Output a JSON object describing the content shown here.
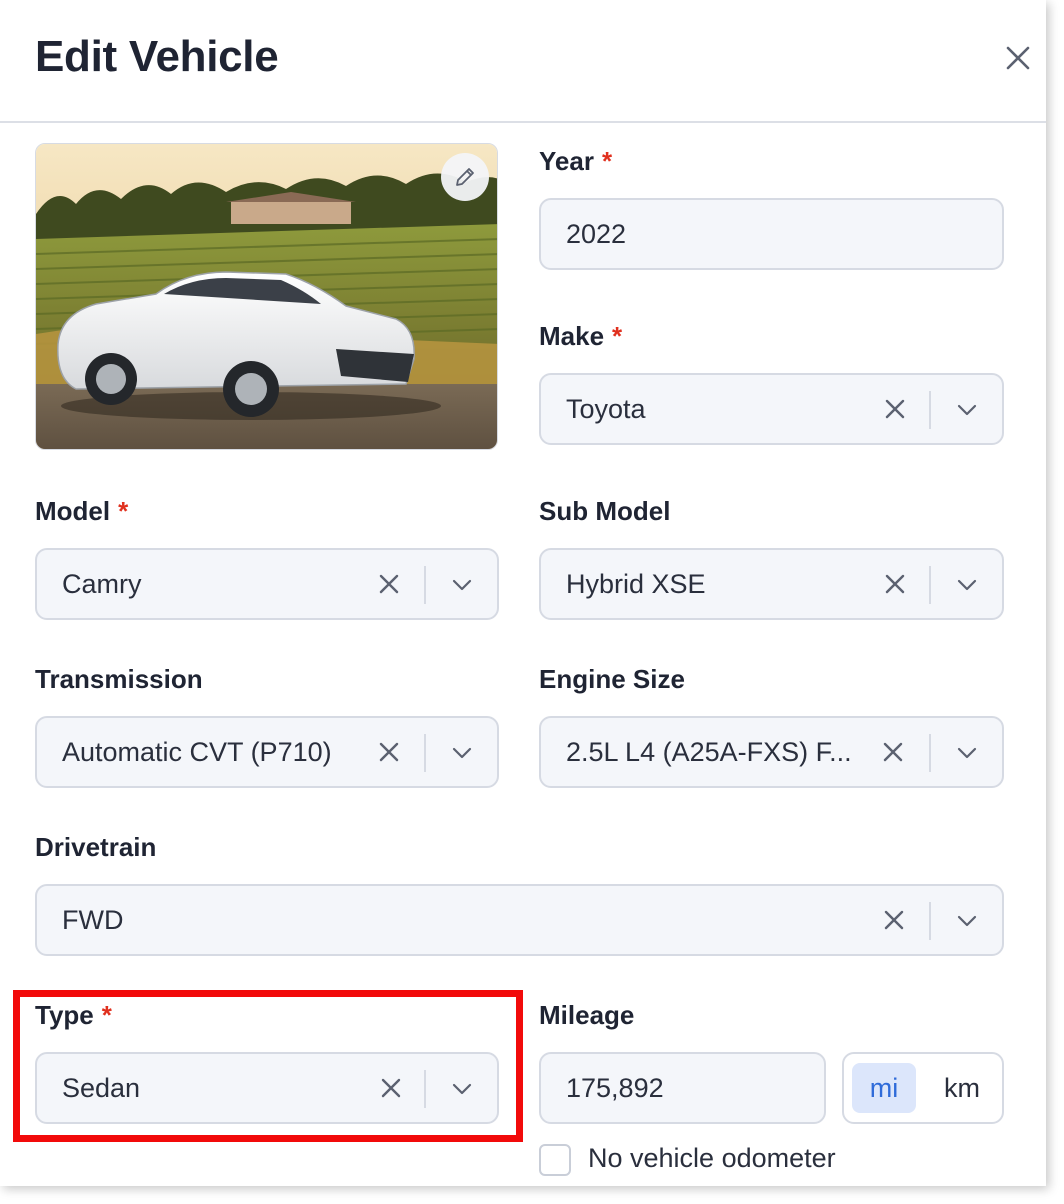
{
  "dialog": {
    "title": "Edit Vehicle",
    "close_icon": "close-icon",
    "photo_edit_icon": "pencil-icon"
  },
  "fields": {
    "year": {
      "label": "Year",
      "required": "*",
      "value": "2022"
    },
    "make": {
      "label": "Make",
      "required": "*",
      "value": "Toyota"
    },
    "model": {
      "label": "Model",
      "required": "*",
      "value": "Camry"
    },
    "sub_model": {
      "label": "Sub Model",
      "value": "Hybrid XSE"
    },
    "transmission": {
      "label": "Transmission",
      "value": "Automatic CVT (P710)"
    },
    "engine_size": {
      "label": "Engine Size",
      "value": "2.5L L4 (A25A-FXS) F..."
    },
    "drivetrain": {
      "label": "Drivetrain",
      "value": "FWD"
    },
    "type": {
      "label": "Type",
      "required": "*",
      "value": "Sedan"
    },
    "mileage": {
      "label": "Mileage",
      "value": "175,892",
      "unit_mi": "mi",
      "unit_km": "km",
      "selected_unit": "mi"
    },
    "no_odometer": {
      "label": "No vehicle odometer",
      "checked": false
    }
  },
  "colors": {
    "required": "#e0301e",
    "accent": "#2f6bd9",
    "highlight": "#f20a0a",
    "field_bg": "#f4f6fa"
  }
}
